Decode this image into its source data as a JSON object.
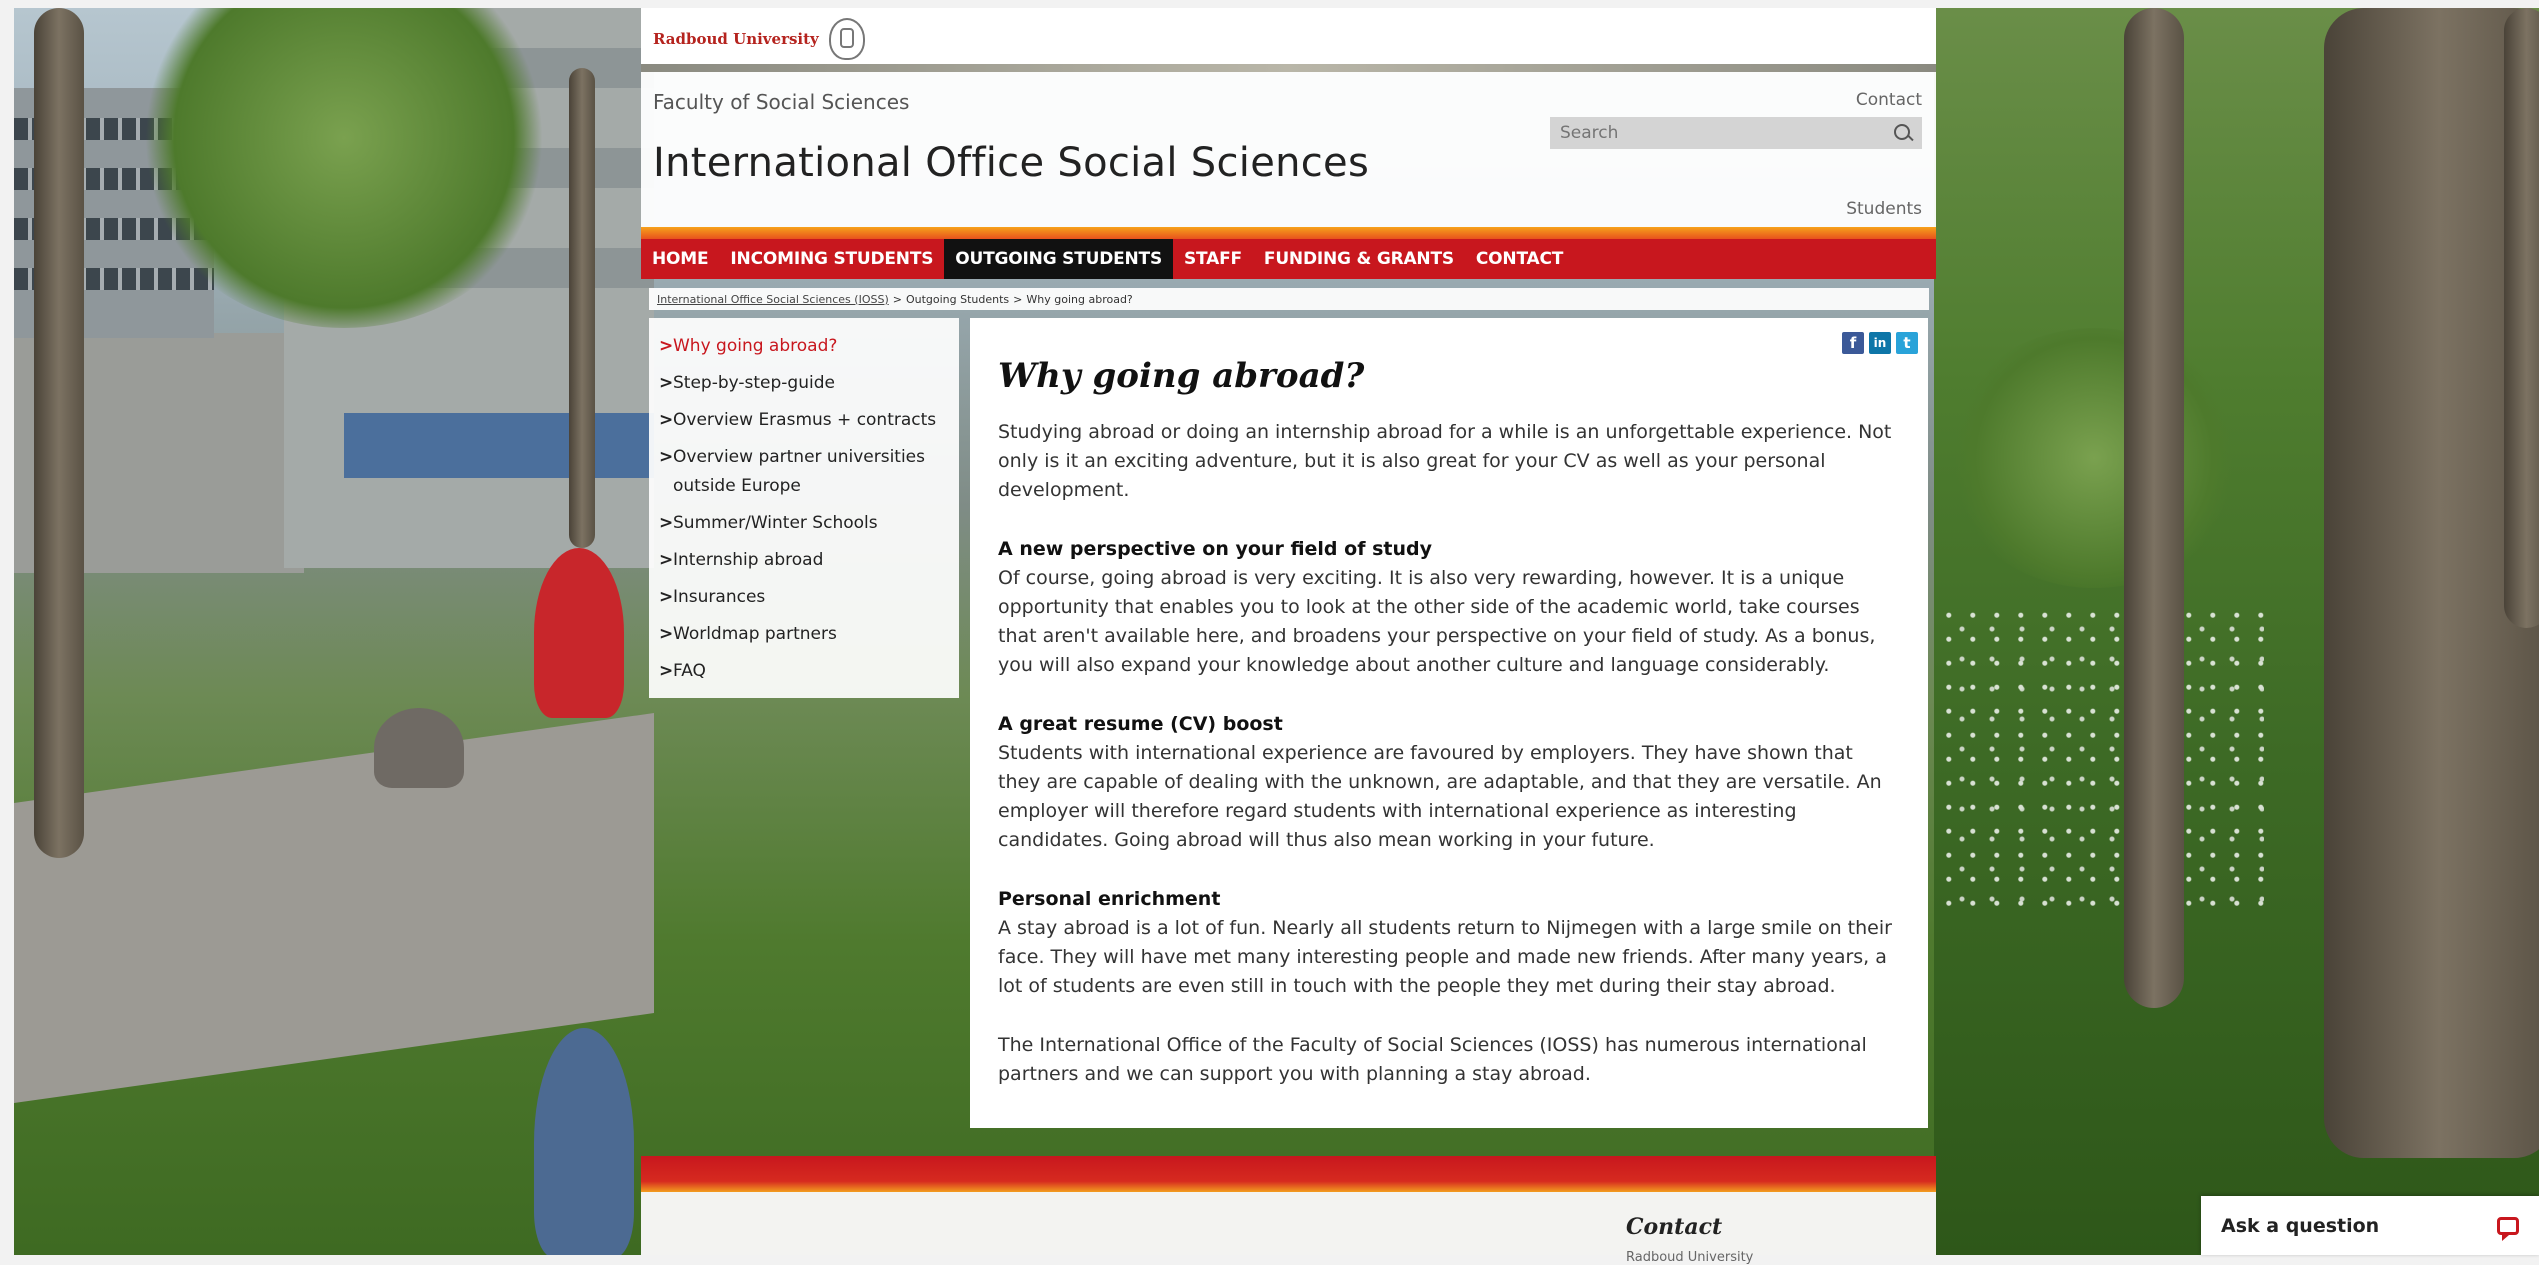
{
  "logo": {
    "text": "Radboud University"
  },
  "header": {
    "faculty": "Faculty of Social Sciences",
    "title": "International Office Social Sciences",
    "contact_link": "Contact",
    "search_placeholder": "Search",
    "students_link": "Students"
  },
  "nav": {
    "items": [
      {
        "label": "HOME"
      },
      {
        "label": "INCOMING STUDENTS"
      },
      {
        "label": "OUTGOING STUDENTS",
        "active": true
      },
      {
        "label": "STAFF"
      },
      {
        "label": "FUNDING & GRANTS"
      },
      {
        "label": "CONTACT"
      }
    ]
  },
  "breadcrumb": {
    "items": [
      "International Office Social Sciences (IOSS)",
      "Outgoing Students",
      "Why going abroad?"
    ],
    "separator": ">"
  },
  "sidebar": {
    "items": [
      {
        "label": "Why going abroad?",
        "active": true
      },
      {
        "label": "Step-by-step-guide"
      },
      {
        "label": "Overview Erasmus + contracts"
      },
      {
        "label": "Overview partner universities outside Europe"
      },
      {
        "label": "Summer/Winter Schools"
      },
      {
        "label": "Internship abroad"
      },
      {
        "label": "Insurances"
      },
      {
        "label": "Worldmap partners"
      },
      {
        "label": "FAQ"
      }
    ],
    "chevron": ">"
  },
  "share": {
    "facebook": "f",
    "linkedin": "in",
    "twitter": "t"
  },
  "main": {
    "title": "Why going abroad?",
    "intro": "Studying abroad or doing an internship abroad for a while is an unforgettable experience. Not only is it an exciting adventure, but it is also great for your CV as well as your personal development.",
    "sections": [
      {
        "heading": "A new perspective on your field of study",
        "text": "Of course, going abroad is very exciting. It is also very rewarding, however. It is a unique opportunity that enables you to look at the other side of the academic world, take courses that aren't available here, and broadens your perspective on your field of study. As a bonus, you will also expand your knowledge about another culture and language considerably."
      },
      {
        "heading": "A great resume (CV) boost",
        "text": "Students with international experience are favoured by employers. They have shown that they are capable of dealing with the unknown, are adaptable, and that they are versatile. An employer will therefore regard students with international experience as interesting candidates. Going abroad will thus also mean working in your future."
      },
      {
        "heading": "Personal enrichment",
        "text": "A stay abroad is a lot of fun. Nearly all students return to Nijmegen with a large smile on their face. They will have met many interesting people and made new friends. After many years, a lot of students are even still in touch with the people they met during their stay abroad."
      }
    ],
    "closing": "The International Office of the Faculty of Social Sciences (IOSS) has numerous international partners and we can support you with planning a stay abroad."
  },
  "footer": {
    "contact_heading": "Contact",
    "contact_sub": "Radboud University"
  },
  "ask": {
    "label": "Ask a question"
  },
  "colors": {
    "brand_red": "#c8171e",
    "accent_orange": "#f39d1f",
    "nav_active": "#111111"
  }
}
